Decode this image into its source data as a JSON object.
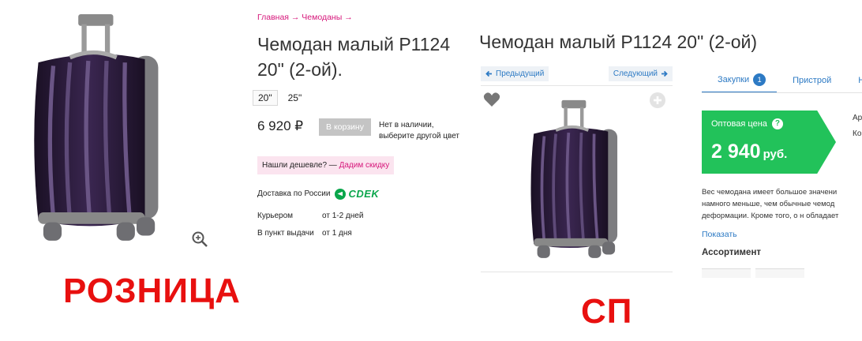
{
  "retail": {
    "caption": "РОЗНИЦА",
    "breadcrumb": "Главная → Чемоданы →",
    "title": "Чемодан малый P1124 20\" (2-ой).",
    "sizes": [
      "20\"",
      "25\""
    ],
    "active_size": "20\"",
    "price": "6 920 ₽",
    "cart_button": "В корзину",
    "stock_line1": "Нет в наличии,",
    "stock_line2": "выберите другой цвет",
    "cheaper_text": "Нашли дешевле? —",
    "cheaper_link": "Дадим скидку",
    "delivery_label": "Доставка по России",
    "delivery_brand": "CDEK",
    "delivery_rows": [
      {
        "method": "Курьером",
        "time": "от 1-2 дней"
      },
      {
        "method": "В пункт выдачи",
        "time": "от 1 дня"
      }
    ],
    "icons": {
      "zoom": "zoom-in-icon"
    }
  },
  "sp": {
    "caption": "СП",
    "title": "Чемодан малый P1124 20\" (2-ой)",
    "prev_button": "Предыдущий",
    "next_button": "Следующий",
    "tabs": [
      {
        "label": "Закупки",
        "badge": "1"
      },
      {
        "label": "Пристрой"
      },
      {
        "label": "Н"
      }
    ],
    "wholesale_label": "Оптовая цена",
    "wholesale_price": "2 940",
    "wholesale_currency": "руб.",
    "side_edge_lines": [
      "Ар",
      "Ко"
    ],
    "description_lines": [
      "Вес чемодана имеет большое значени",
      "намного меньше, чем обычные чемод",
      "деформации. Кроме того, о н обладает"
    ],
    "show_link": "Показать",
    "assortment": "Ассортимент"
  },
  "colors": {
    "accent_pink": "#d6167a",
    "link_blue": "#2d7ac4",
    "wholesale_green": "#22c25a",
    "caption_red": "#e8100f",
    "suitcase_body": "#2b1b3a"
  }
}
